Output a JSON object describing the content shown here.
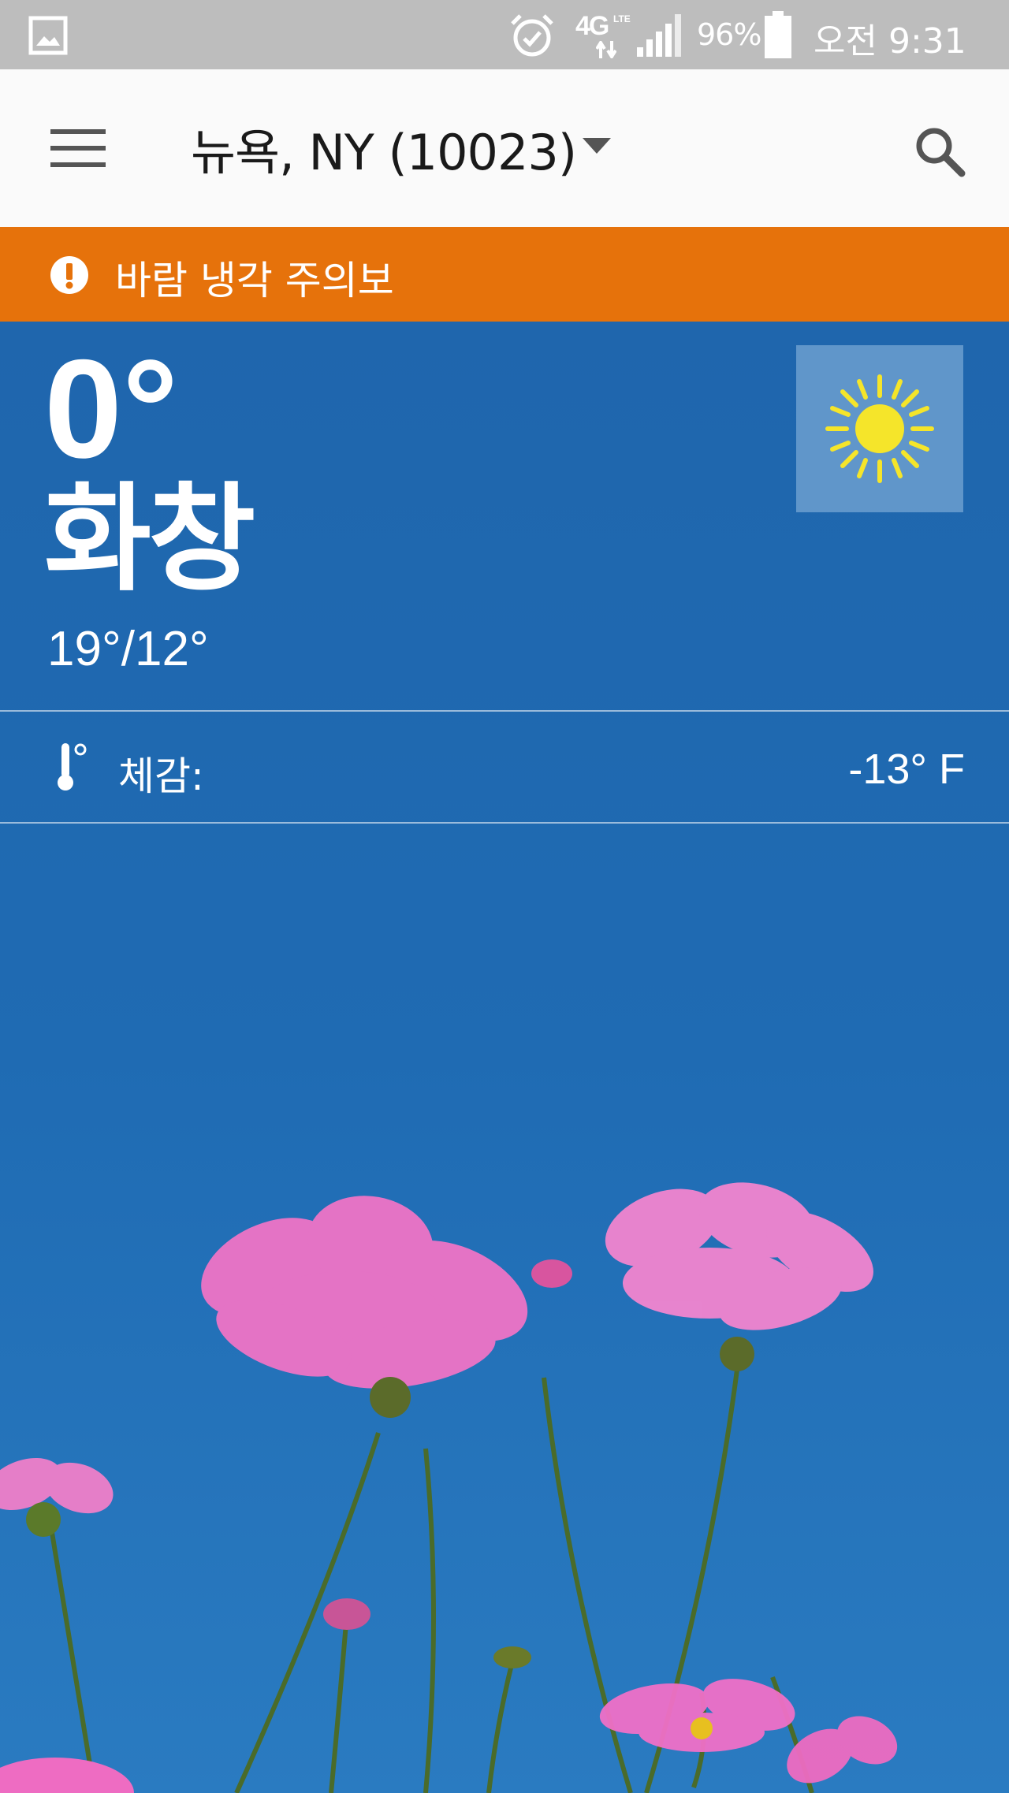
{
  "status_bar": {
    "network": "4G",
    "network_sub": "LTE",
    "battery": "96%",
    "time": "오전 9:31"
  },
  "app_bar": {
    "location": "뉴욕, NY (10023)"
  },
  "alert": {
    "text": "바람 냉각 주의보"
  },
  "weather": {
    "current_temp": "0°",
    "condition": "화창",
    "hi_lo": "19°/12°",
    "feels_like_label": "체감:",
    "feels_like_value": "-13° F",
    "icon": "sun-icon"
  },
  "colors": {
    "status_bar": "#bdbdbd",
    "app_bar": "#fafafa",
    "alert": "#e6720b",
    "sky": "#1f66ad",
    "sun": "#f5e52a",
    "flower": "#f070c8"
  }
}
